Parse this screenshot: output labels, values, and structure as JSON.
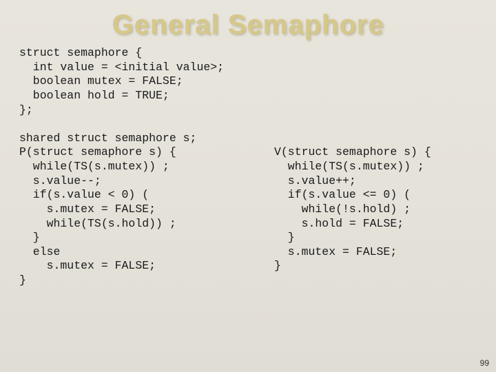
{
  "title": "General Semaphore",
  "struct_block": "struct semaphore {\n  int value = <initial value>;\n  boolean mutex = FALSE;\n  boolean hold = TRUE;\n};\n\nshared struct semaphore s;\n",
  "p_func": "P(struct semaphore s) {\n  while(TS(s.mutex)) ;\n  s.value--;\n  if(s.value < 0) (\n    s.mutex = FALSE;\n    while(TS(s.hold)) ;\n  }\n  else\n    s.mutex = FALSE;\n}",
  "v_func": "V(struct semaphore s) {\n  while(TS(s.mutex)) ;\n  s.value++;\n  if(s.value <= 0) (\n    while(!s.hold) ;\n    s.hold = FALSE;\n  }\n  s.mutex = FALSE;\n}",
  "page_number": "99"
}
